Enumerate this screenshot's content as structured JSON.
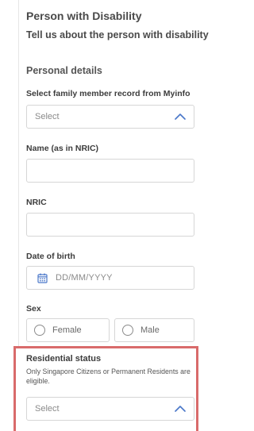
{
  "section": {
    "title": "Person with Disability",
    "subtitle": "Tell us about the person with disability"
  },
  "personal_details": {
    "title": "Personal details",
    "myinfo": {
      "label": "Select family member record from Myinfo",
      "value": "Select",
      "icon": "chevron-up-icon"
    },
    "name": {
      "label": "Name (as in NRIC)",
      "value": ""
    },
    "nric": {
      "label": "NRIC",
      "value": ""
    },
    "dob": {
      "label": "Date of birth",
      "placeholder": "DD/MM/YYYY",
      "icon": "calendar-icon"
    },
    "sex": {
      "label": "Sex",
      "options": [
        "Female",
        "Male"
      ]
    }
  },
  "residential_status": {
    "label": "Residential status",
    "help": "Only Singapore Citizens or Permanent Residents are eligible.",
    "value": "Select",
    "icon": "chevron-up-icon",
    "highlight_color": "#d96b6b"
  },
  "colors": {
    "accent": "#4a77c9",
    "border": "#d6d6d6",
    "text": "#3c3c3c"
  }
}
